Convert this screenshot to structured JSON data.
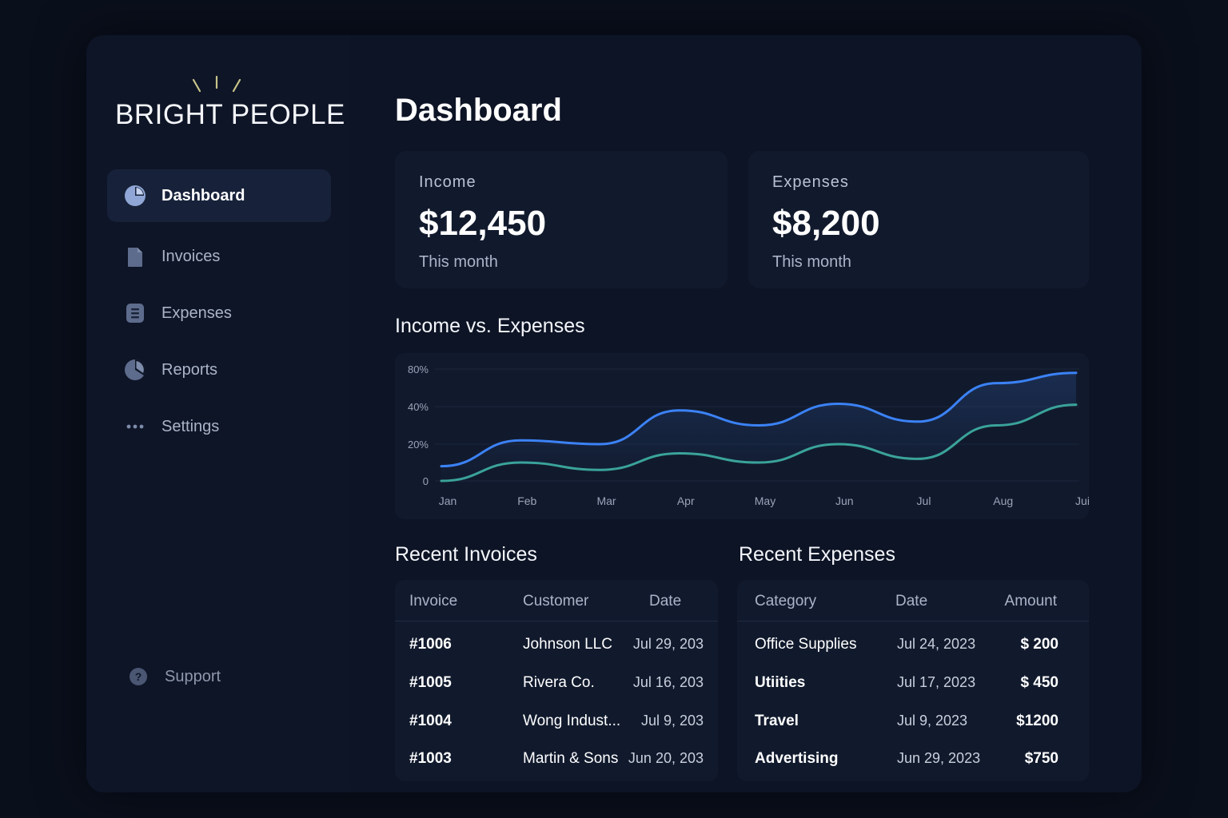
{
  "brand": {
    "name": "BRIGHT PEOPLE"
  },
  "sidebar": {
    "items": [
      {
        "label": "Dashboard",
        "icon": "pie-chart-icon",
        "active": true
      },
      {
        "label": "Invoices",
        "icon": "document-icon",
        "active": false
      },
      {
        "label": "Expenses",
        "icon": "list-icon",
        "active": false
      },
      {
        "label": "Reports",
        "icon": "pie-chart-icon",
        "active": false
      },
      {
        "label": "Settings",
        "icon": "more-dots-icon",
        "active": false
      }
    ],
    "support": {
      "label": "Support",
      "icon": "help-icon"
    }
  },
  "main": {
    "title": "Dashboard",
    "cards": [
      {
        "label": "Income",
        "value": "$12,450",
        "sub": "This month"
      },
      {
        "label": "Expenses",
        "value": "$8,200",
        "sub": "This month"
      }
    ],
    "chart_title": "Income vs. Expenses",
    "invoices_title": "Recent Invoices",
    "expenses_title": "Recent Expenses"
  },
  "chart_data": {
    "type": "line",
    "title": "Income vs. Expenses",
    "x": [
      "Jan",
      "Feb",
      "Mar",
      "Apr",
      "May",
      "Jun",
      "Jul",
      "Aug",
      "Jui"
    ],
    "y_ticks": [
      "80%",
      "40%",
      "20%",
      "0"
    ],
    "ylim": [
      0,
      80
    ],
    "series": [
      {
        "values": [
          8,
          22,
          20,
          38,
          30,
          43,
          32,
          65,
          76
        ],
        "color": "#3b82f6"
      },
      {
        "values": [
          0,
          10,
          6,
          15,
          10,
          20,
          12,
          30,
          42
        ],
        "color": "#3aa39a"
      }
    ],
    "grid": true
  },
  "invoices": {
    "headers": [
      "Invoice",
      "Customer",
      "Date"
    ],
    "rows": [
      {
        "invoice": "#1006",
        "customer": "Johnson LLC",
        "date": "Jul 29, 203"
      },
      {
        "invoice": "#1005",
        "customer": "Rivera Co.",
        "date": "Jul 16, 203"
      },
      {
        "invoice": "#1004",
        "customer": "Wong Indust...",
        "date": "Jul 9, 203"
      },
      {
        "invoice": "#1003",
        "customer": "Martin & Sons",
        "date": "Jun 20, 203"
      }
    ]
  },
  "expenses": {
    "headers": [
      "Category",
      "Date",
      "Amount"
    ],
    "rows": [
      {
        "category": "Office Supplies",
        "date": "Jul 24, 2023",
        "amount": "$ 200"
      },
      {
        "category": "Utiities",
        "date": "Jul 17, 2023",
        "amount": "$ 450"
      },
      {
        "category": "Travel",
        "date": "Jul 9, 2023",
        "amount": "$1200"
      },
      {
        "category": "Advertising",
        "date": "Jun 29, 2023",
        "amount": "$750"
      }
    ]
  },
  "colors": {
    "accent": "#3b82f6",
    "secondary": "#3aa39a",
    "background": "#0a0f1c",
    "panel": "#111a2d"
  }
}
